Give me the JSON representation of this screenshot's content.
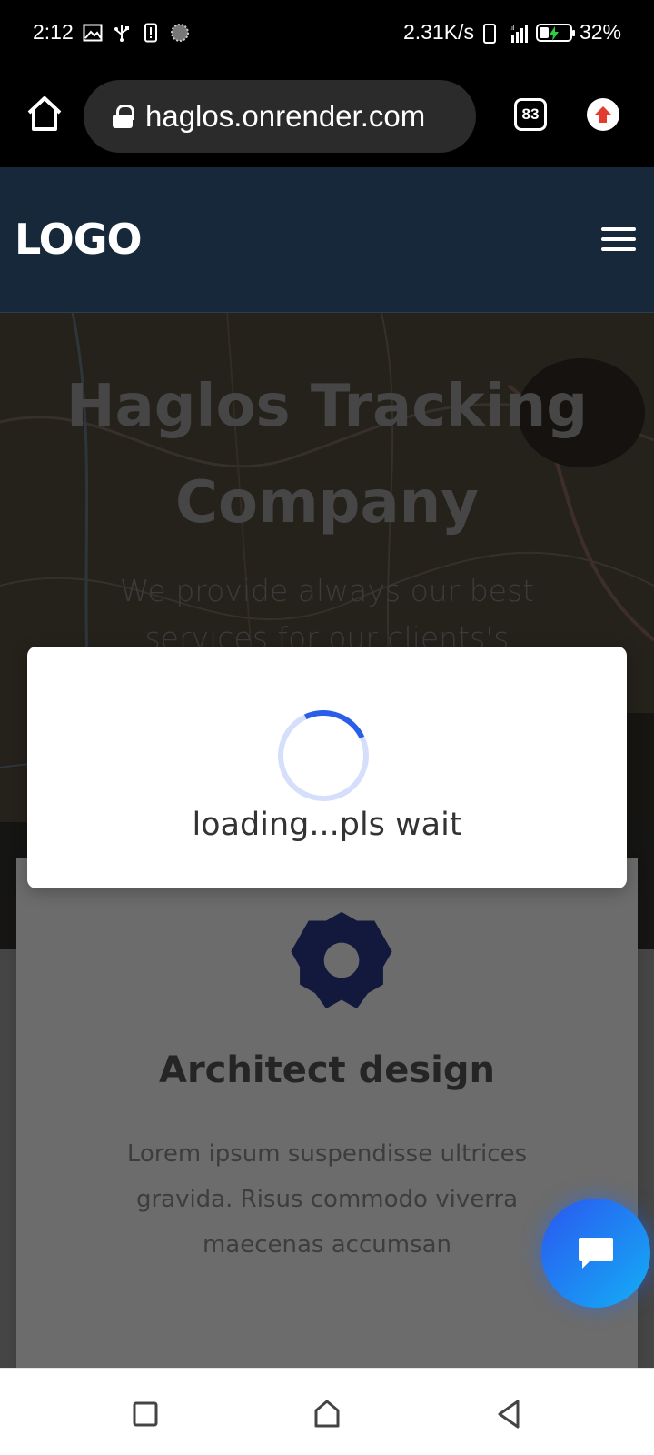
{
  "status_bar": {
    "time": "2:12",
    "net_speed": "2.31K/s",
    "battery_percent": "32%",
    "battery_level": 0.32,
    "icons_left": [
      "image-icon",
      "usb-icon",
      "alert-phone-icon",
      "circle-icon"
    ],
    "icons_right": [
      "phone-outline-icon",
      "signal-icon",
      "battery-charging-icon"
    ]
  },
  "browser": {
    "url": "haglos.onrender.com",
    "tab_count": "83",
    "icons": [
      "home-icon",
      "lock-icon",
      "tabs-icon",
      "upload-extension-icon"
    ]
  },
  "site": {
    "logo": "LOGO",
    "hero_title": "Haglos Tracking Company",
    "hero_subtitle": "We provide always our best services for our clients's",
    "card": {
      "title": "Architect design",
      "text": "Lorem ipsum suspendisse ultrices gravida. Risus commodo viverra maecenas accumsan"
    }
  },
  "modal": {
    "message": "loading...pls wait"
  },
  "colors": {
    "header_bg": "#17283a",
    "gear": "#24337a",
    "chat_gradient_start": "#2b57f0",
    "chat_gradient_end": "#13aef5",
    "spinner": "#2a5ee8"
  },
  "nav": {
    "buttons": [
      "recents-square-icon",
      "home-pentagon-icon",
      "back-triangle-icon"
    ]
  }
}
